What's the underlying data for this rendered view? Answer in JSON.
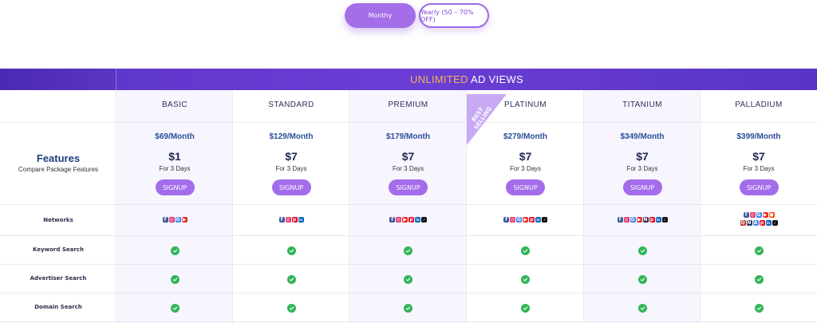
{
  "toggle": {
    "monthly_label": "Monthy",
    "yearly_label": "Yearly (50 – 70% OFF)"
  },
  "band": {
    "highlight": "UNLIMITED",
    "rest": " AD VIEWS"
  },
  "features": {
    "title": "Features",
    "subtitle": "Compare Package Features"
  },
  "ribbon": {
    "text": "BEST SELLING"
  },
  "rows": {
    "networks": "Networks",
    "keyword": "Keyword Search",
    "advertiser": "Advertiser Search",
    "domain": "Domain Search"
  },
  "plans": [
    {
      "name": "BASIC",
      "price": "$69/Month",
      "trial": "$1",
      "days": "For 3 Days",
      "signup": "SIGNUP",
      "networks": [
        [
          "facebook-icon"
        ],
        [
          "instagram-icon",
          "google-icon",
          "youtube-icon"
        ]
      ]
    },
    {
      "name": "STANDARD",
      "price": "$129/Month",
      "trial": "$7",
      "days": "For 3 Days",
      "signup": "SIGNUP",
      "networks": []
    },
    {
      "name": "PREMIUM",
      "price": "$179/Month",
      "trial": "$7",
      "days": "For 3 Days",
      "signup": "SIGNUP",
      "networks": []
    },
    {
      "name": "PLATINUM",
      "price": "$279/Month",
      "trial": "$7",
      "days": "For 3 Days",
      "signup": "SIGNUP",
      "networks": []
    },
    {
      "name": "TITANIUM",
      "price": "$349/Month",
      "trial": "$7",
      "days": "For 3 Days",
      "signup": "SIGNUP",
      "networks": []
    },
    {
      "name": "PALLADIUM",
      "price": "$399/Month",
      "trial": "$7",
      "days": "For 3 Days",
      "signup": "SIGNUP",
      "networks": []
    }
  ],
  "colors": {
    "accent": "#a46ee8",
    "band": "#5c34c8",
    "check": "#32b558",
    "highlight": "#f2b25b"
  }
}
